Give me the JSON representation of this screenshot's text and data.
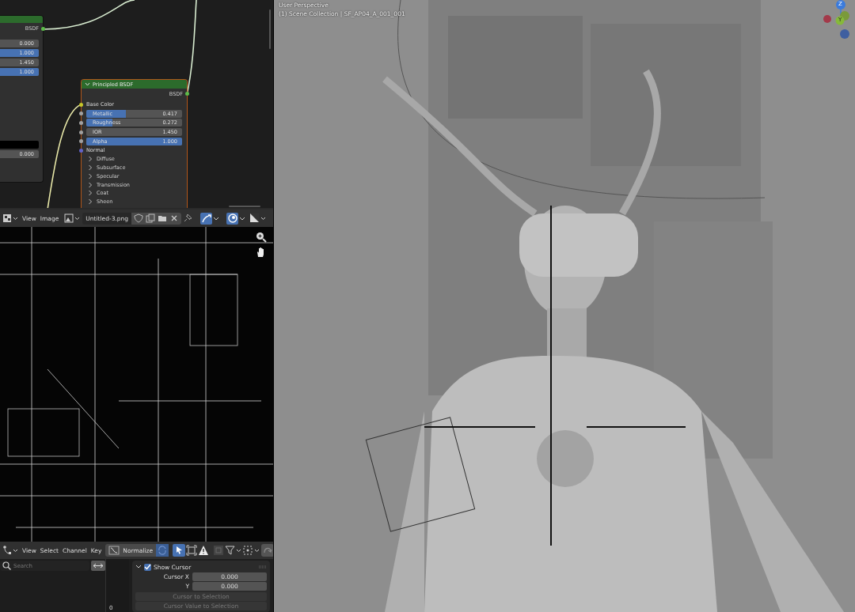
{
  "node_editor": {
    "left_node": {
      "output": "BSDF",
      "rows": [
        {
          "kind": "slider",
          "value": "0.000",
          "level": 0
        },
        {
          "kind": "slider",
          "value": "1.000",
          "level": 1
        },
        {
          "kind": "number",
          "value": "1.450"
        },
        {
          "kind": "slider",
          "value": "1.000",
          "level": 1
        },
        {
          "kind": "swatch"
        },
        {
          "kind": "number",
          "value": "0.000"
        }
      ]
    },
    "principled": {
      "title": "Principled BSDF",
      "expanded": true,
      "output": "BSDF",
      "inputs": [
        {
          "kind": "label",
          "label": "Base Color",
          "color": "#c7c729"
        },
        {
          "kind": "slider",
          "label": "Metallic",
          "value": "0.417",
          "level": 0.417,
          "color": "#a1a1a1"
        },
        {
          "kind": "slider",
          "label": "Roughness",
          "value": "0.272",
          "level": 0.272,
          "color": "#a1a1a1"
        },
        {
          "kind": "number",
          "label": "IOR",
          "value": "1.450",
          "color": "#a1a1a1"
        },
        {
          "kind": "slider",
          "label": "Alpha",
          "value": "1.000",
          "level": 1,
          "color": "#a1a1a1"
        },
        {
          "kind": "label",
          "label": "Normal",
          "color": "#6363c7"
        }
      ],
      "panels": [
        {
          "label": "Diffuse",
          "expanded": false
        },
        {
          "label": "Subsurface",
          "expanded": false
        },
        {
          "label": "Specular",
          "expanded": false
        },
        {
          "label": "Transmission",
          "expanded": false
        },
        {
          "label": "Coat",
          "expanded": false
        },
        {
          "label": "Sheen",
          "expanded": false
        }
      ]
    }
  },
  "image_editor": {
    "menus": [
      "View",
      "Image"
    ],
    "image_name": "Untitled-3.png",
    "toggles": [
      {
        "on": true
      },
      {
        "on": true
      }
    ]
  },
  "graph_editor": {
    "menus": [
      "View",
      "Select",
      "Channel",
      "Key"
    ],
    "normalize": {
      "label": "Normalize",
      "on": false
    },
    "search": {
      "placeholder": "Search"
    },
    "cursor_panel": {
      "label": "Show Cursor",
      "checked": true,
      "expanded": true,
      "fields": [
        {
          "label": "Cursor X",
          "value": "0.000"
        },
        {
          "label": "Y",
          "value": "0.000"
        }
      ],
      "buttons": [
        {
          "label": "Cursor to Selection",
          "disabled": true
        },
        {
          "label": "Cursor Value to Selection",
          "disabled": true
        }
      ]
    },
    "axis_label": "0"
  },
  "viewport": {
    "view_name": "User Perspective",
    "collection": "(1) Scene Collection | SF_AP04_A_001_001",
    "gizmo": {
      "z": "Z",
      "y": "Y"
    }
  }
}
